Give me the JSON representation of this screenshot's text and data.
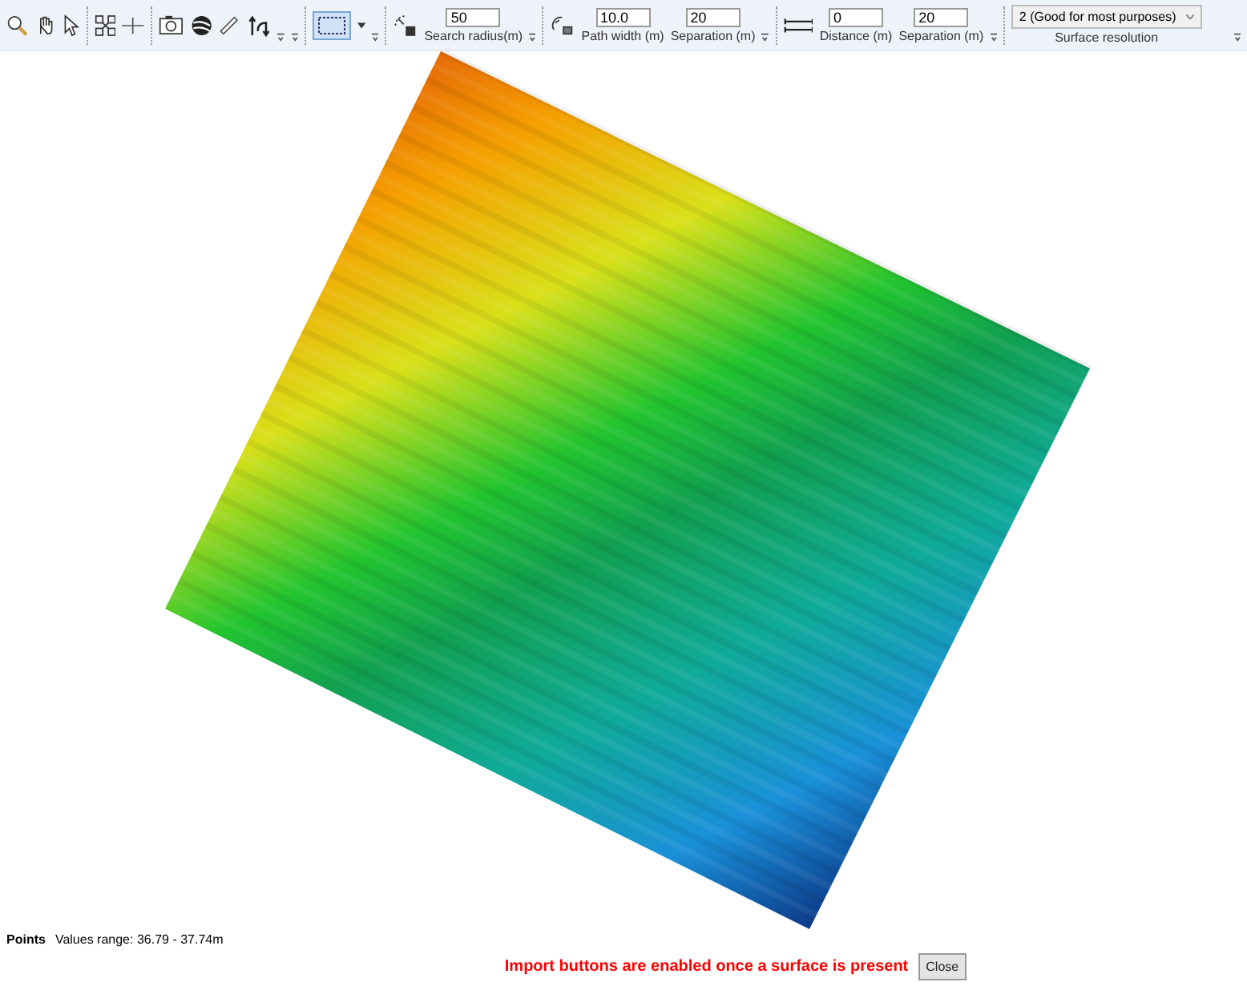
{
  "toolbar": {
    "groups": [
      {
        "kind": "radius",
        "fields": [
          {
            "value": "50",
            "label": "Search radius(m)"
          }
        ]
      },
      {
        "kind": "path",
        "fields": [
          {
            "value": "10.0",
            "label": "Path width (m)"
          },
          {
            "value": "20",
            "label": "Separation (m)"
          }
        ]
      },
      {
        "kind": "parallel",
        "fields": [
          {
            "value": "0",
            "label": "Distance (m)"
          },
          {
            "value": "20",
            "label": "Separation (m)"
          }
        ]
      }
    ],
    "resolution": {
      "value": "2 (Good for most purposes)",
      "label": "Surface resolution"
    }
  },
  "status": {
    "title": "Points",
    "range": "Values range: 36.79 - 37.74m"
  },
  "message": "Import buttons are enabled once a surface is present",
  "buttons": [
    "Close"
  ]
}
